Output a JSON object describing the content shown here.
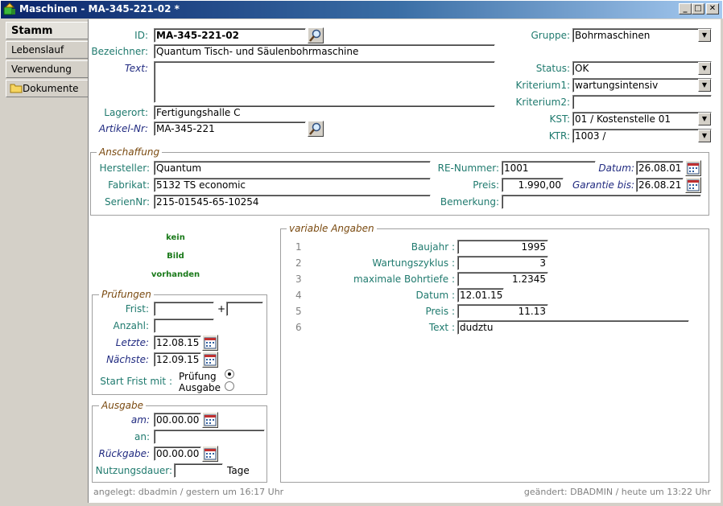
{
  "window": {
    "title": "Maschinen - MA-345-221-02 *",
    "min": "_",
    "max": "□",
    "close": "✕"
  },
  "sidebar": {
    "items": [
      {
        "label": "Stamm"
      },
      {
        "label": "Lebenslauf"
      },
      {
        "label": "Verwendung"
      },
      {
        "label": "Dokumente"
      }
    ]
  },
  "header": {
    "id_label": "ID:",
    "id_value": "MA-345-221-02",
    "bez_label": "Bezeichner:",
    "bez_value": "Quantum Tisch- und Säulenbohrmaschine",
    "text_label": "Text:",
    "text_value": "",
    "lager_label": "Lagerort:",
    "lager_value": "Fertigungshalle C",
    "artikel_label": "Artikel-Nr:",
    "artikel_value": "MA-345-221",
    "gruppe_label": "Gruppe:",
    "gruppe_value": "Bohrmaschinen",
    "status_label": "Status:",
    "status_value": "OK",
    "krit1_label": "Kriterium1:",
    "krit1_value": "wartungsintensiv",
    "krit2_label": "Kriterium2:",
    "krit2_value": "",
    "kst_label": "KST:",
    "kst_value": "01 / Kostenstelle 01",
    "ktr_label": "KTR:",
    "ktr_value": "1003 /"
  },
  "anschaffung": {
    "title": "Anschaffung",
    "hersteller_label": "Hersteller:",
    "hersteller_value": "Quantum",
    "fabrikat_label": "Fabrikat:",
    "fabrikat_value": "5132 TS economic",
    "serien_label": "SerienNr:",
    "serien_value": "215-01545-65-10254",
    "re_label": "RE-Nummer:",
    "re_value": "1001",
    "preis_label": "Preis:",
    "preis_value": "1.990,00",
    "bem_label": "Bemerkung:",
    "bem_value": "",
    "datum_label": "Datum:",
    "datum_value": "26.08.01",
    "garantie_label": "Garantie bis:",
    "garantie_value": "26.08.21"
  },
  "image_placeholder": {
    "line1": "kein",
    "line2": "Bild",
    "line3": "vorhanden"
  },
  "pruefungen": {
    "title": "Prüfungen",
    "frist_label": "Frist:",
    "frist_value": "",
    "plus": "+",
    "frist_extra": "",
    "anzahl_label": "Anzahl:",
    "anzahl_value": "",
    "letzte_label": "Letzte:",
    "letzte_value": "12.08.15",
    "naechste_label": "Nächste:",
    "naechste_value": "12.09.15",
    "start_label": "Start Frist mit :",
    "opt1": "Prüfung",
    "opt2": "Ausgabe",
    "selected": "Prüfung"
  },
  "ausgabe": {
    "title": "Ausgabe",
    "am_label": "am:",
    "am_value": "00.00.00",
    "an_label": "an:",
    "an_value": "",
    "rueck_label": "Rückgabe:",
    "rueck_value": "00.00.00",
    "nutz_label": "Nutzungsdauer:",
    "nutz_value": "",
    "nutz_unit": "Tage"
  },
  "variable": {
    "title": "variable Angaben",
    "rows": [
      {
        "n": "1",
        "label": "Baujahr :",
        "value": "1995"
      },
      {
        "n": "2",
        "label": "Wartungszyklus :",
        "value": "3"
      },
      {
        "n": "3",
        "label": "maximale Bohrtiefe :",
        "value": "1.2345"
      },
      {
        "n": "4",
        "label": "Datum :",
        "value": "12.01.15"
      },
      {
        "n": "5",
        "label": "Preis :",
        "value": "11.13"
      },
      {
        "n": "6",
        "label": "Text :",
        "value": "dudztu"
      }
    ]
  },
  "footer": {
    "created": "angelegt: dbadmin / gestern um 16:17 Uhr",
    "changed": "geändert: DBADMIN / heute um 13:22 Uhr"
  }
}
